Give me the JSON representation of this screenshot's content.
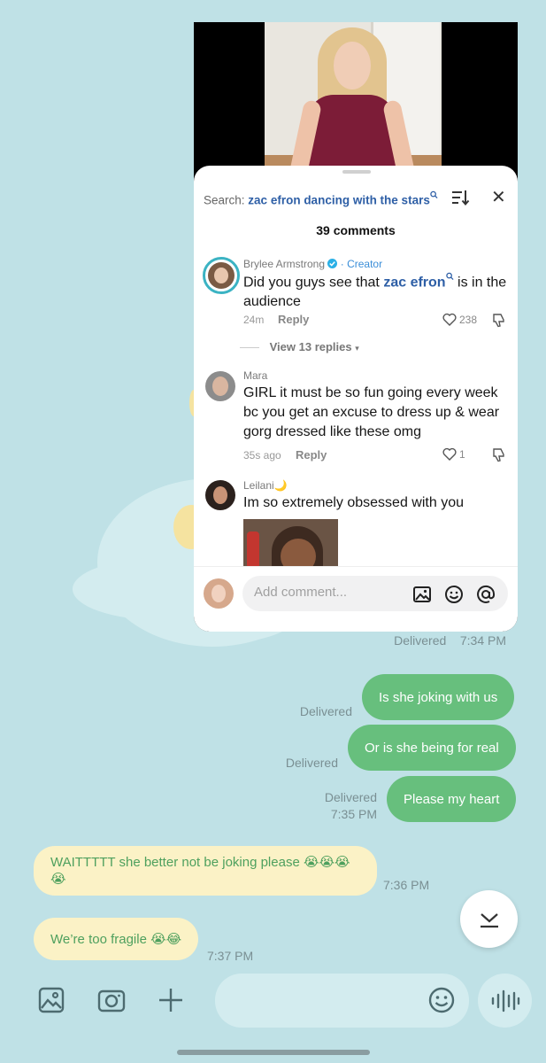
{
  "comments_panel": {
    "search_prefix": "Search:",
    "search_query": "zac efron dancing with the stars",
    "count": "39 comments",
    "comments": [
      {
        "name": "Brylee Armstrong",
        "badge": "· Creator",
        "text_before": "Did you guys see that",
        "highlight": "zac efron",
        "text_after": "is in the audience",
        "time": "24m",
        "reply": "Reply",
        "likes": "238",
        "view_replies": "View 13 replies"
      },
      {
        "name": "Mara",
        "text": "GIRL it must be so fun going every week bc you get an excuse to dress up & wear gorg dressed like these omg",
        "time": "35s ago",
        "reply": "Reply",
        "likes": "1"
      },
      {
        "name": "Leilani🌙",
        "text": "Im so extremely obsessed with you"
      }
    ],
    "composer_placeholder": "Add comment..."
  },
  "chat": {
    "first_status": "Delivered",
    "first_time": "7:34 PM",
    "outgoing": [
      {
        "text": "Is she joking with us",
        "status": "Delivered"
      },
      {
        "text": "Or is she being for real",
        "status": "Delivered"
      },
      {
        "text": "Please my heart",
        "status": "Delivered",
        "time": "7:35 PM"
      }
    ],
    "incoming": [
      {
        "text": "WAITTTTT she better not be joking please 😭😭😭😭",
        "time": "7:36 PM"
      },
      {
        "text": "We’re too fragile 😭😂",
        "time": "7:37 PM"
      }
    ]
  },
  "composer": {
    "placeholder": ""
  },
  "icons": [
    "gallery-icon",
    "camera-icon",
    "plus-icon",
    "emoji-icon",
    "voice-icon",
    "chevron-down-icon"
  ],
  "colors": {
    "background": "#bfe1e6",
    "outgoing_bubble": "#67bf7d",
    "incoming_bubble": "#fbf2c6",
    "incoming_text": "#4ea05e",
    "highlight": "#2e5fa6"
  }
}
